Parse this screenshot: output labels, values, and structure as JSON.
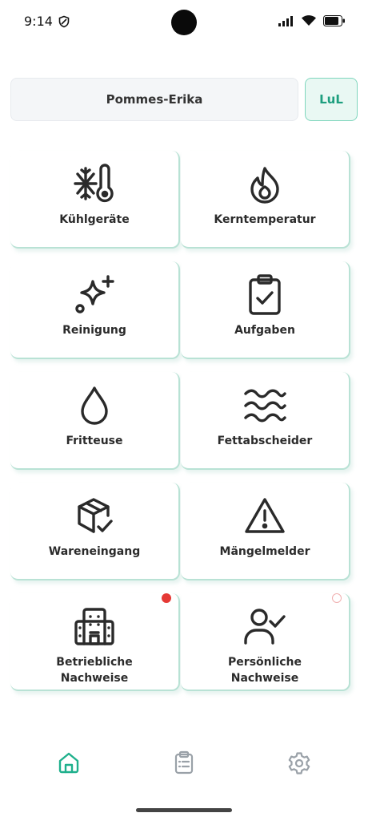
{
  "status_bar": {
    "time": "9:14"
  },
  "header": {
    "location": "Pommes-Erika",
    "user_initials": "LuL"
  },
  "tiles": [
    {
      "label": "Kühlgeräte",
      "icon": "fridge-thermometer-icon"
    },
    {
      "label": "Kerntemperatur",
      "icon": "flame-icon"
    },
    {
      "label": "Reinigung",
      "icon": "sparkles-icon"
    },
    {
      "label": "Aufgaben",
      "icon": "clipboard-check-icon"
    },
    {
      "label": "Fritteuse",
      "icon": "drop-icon"
    },
    {
      "label": "Fettabscheider",
      "icon": "waves-icon"
    },
    {
      "label": "Wareneingang",
      "icon": "package-check-icon"
    },
    {
      "label": "Mängelmelder",
      "icon": "warning-triangle-icon"
    },
    {
      "label_line1": "Betriebliche",
      "label_line2": "Nachweise",
      "icon": "building-icon"
    },
    {
      "label_line1": "Persönliche",
      "label_line2": "Nachweise",
      "icon": "user-check-icon"
    }
  ],
  "bottom_nav": [
    {
      "name": "home",
      "icon": "home-icon",
      "active": true
    },
    {
      "name": "clipboard",
      "icon": "clipboard-list-icon",
      "active": false
    },
    {
      "name": "settings",
      "icon": "gear-icon",
      "active": false
    }
  ],
  "colors": {
    "accent": "#1fb08c",
    "accent_bg": "#e9f8f3",
    "badge_red": "#e53935",
    "icon_dark": "#2a2a2a",
    "nav_inactive": "#9aa1a8"
  }
}
